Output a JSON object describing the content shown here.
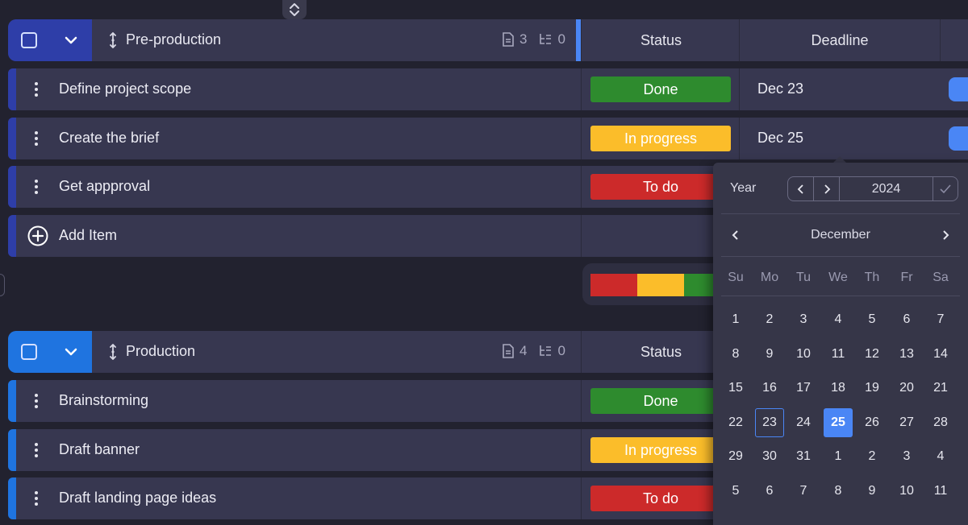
{
  "groups": [
    {
      "name": "Pre-production",
      "doc_count": "3",
      "subitem_count": "0",
      "status_header": "Status",
      "deadline_header": "Deadline",
      "color": "#2e3ea8",
      "items": [
        {
          "name": "Define project scope",
          "status": "Done",
          "deadline": "Dec 23"
        },
        {
          "name": "Create the brief",
          "status": "In progress",
          "deadline": "Dec 25"
        },
        {
          "name": "Get appproval",
          "status": "To do",
          "deadline": ""
        }
      ],
      "add_item_label": "Add Item"
    },
    {
      "name": "Production",
      "doc_count": "4",
      "subitem_count": "0",
      "status_header": "Status",
      "color": "#1f74e0",
      "items": [
        {
          "name": "Brainstorming",
          "status": "Done"
        },
        {
          "name": "Draft banner",
          "status": "In progress"
        },
        {
          "name": "Draft landing page ideas",
          "status": "To do"
        }
      ]
    }
  ],
  "status_colors": {
    "Done": "#2e8b2e",
    "In progress": "#fbbd2a",
    "To do": "#cc2a2a"
  },
  "summary_bar": [
    {
      "status": "To do",
      "fraction": 0.333
    },
    {
      "status": "In progress",
      "fraction": 0.333
    },
    {
      "status": "Done",
      "fraction": 0.333
    }
  ],
  "calendar": {
    "year_label": "Year",
    "year": "2024",
    "month": "December",
    "weekdays": [
      "Su",
      "Mo",
      "Tu",
      "We",
      "Th",
      "Fr",
      "Sa"
    ],
    "weeks": [
      [
        "1",
        "2",
        "3",
        "4",
        "5",
        "6",
        "7"
      ],
      [
        "8",
        "9",
        "10",
        "11",
        "12",
        "13",
        "14"
      ],
      [
        "15",
        "16",
        "17",
        "18",
        "19",
        "20",
        "21"
      ],
      [
        "22",
        "23",
        "24",
        "25",
        "26",
        "27",
        "28"
      ],
      [
        "29",
        "30",
        "31",
        "1",
        "2",
        "3",
        "4"
      ],
      [
        "5",
        "6",
        "7",
        "8",
        "9",
        "10",
        "11"
      ]
    ],
    "today": "23",
    "selected": "25"
  },
  "icons": {
    "expand": "chevron-up-down-icon",
    "collapse": "chevron-down-icon",
    "drag": "drag-handle-icon",
    "doc": "document-icon",
    "subitems": "subitems-icon",
    "menu": "kebab-menu-icon",
    "add": "plus-circle-icon",
    "confirm": "check-icon"
  }
}
